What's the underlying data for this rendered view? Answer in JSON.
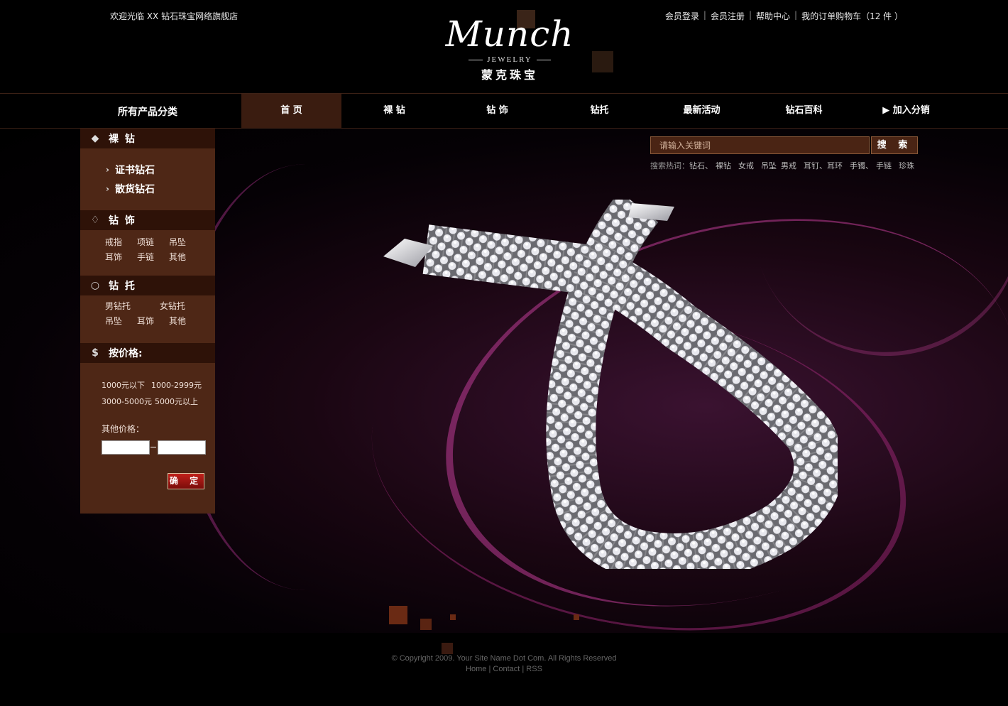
{
  "header": {
    "welcome": "欢迎光临 XX 钻石珠宝网络旗舰店",
    "links": [
      "会员登录",
      "会员注册",
      "帮助中心",
      "我的订单购物车（12 件 ）"
    ],
    "logo_script": "Munch",
    "logo_sub": "JEWELRY",
    "logo_cn": "蒙克珠宝"
  },
  "nav": {
    "all_categories": "所有产品分类",
    "items": [
      "首 页",
      "裸 钻",
      "钻 饰",
      "钻托",
      "最新活动",
      "钻石百科",
      "▶ 加入分销"
    ]
  },
  "sidebar": {
    "loose_diamond": {
      "title": "裸 钻",
      "icon": "diamond-icon",
      "links": [
        "证书钻石",
        "散货钻石"
      ]
    },
    "jewelry": {
      "title": "钻 饰",
      "icon": "shield-gem-icon",
      "items": [
        "戒指",
        "项链",
        "吊坠",
        "耳饰",
        "手链",
        "其他"
      ]
    },
    "mounting": {
      "title": "钻 托",
      "icon": "ring-icon",
      "items": [
        "男钻托",
        "女钻托",
        "吊坠",
        "耳饰",
        "其他"
      ]
    },
    "price": {
      "title": "按价格:",
      "icon": "dollar-icon",
      "options": [
        "1000元以下",
        "1000-2999元",
        "3000-5000元",
        "5000元以上"
      ],
      "other_label": "其他价格：",
      "min_value": "",
      "max_value": "",
      "confirm": "确 定"
    }
  },
  "search": {
    "placeholder": "请输入关键词",
    "button": "搜 索",
    "hot_label": "搜索热词：",
    "hot_words": [
      "钻石、",
      "裸钻",
      "女戒",
      "吊坠",
      "男戒",
      "耳钉、耳环",
      "手镯、",
      "手链",
      "珍珠"
    ]
  },
  "footer": {
    "copyright": "© Copyright 2009. Your Site Name Dot Com. All Rights Reserved",
    "links": [
      "Home",
      "Contact",
      "RSS"
    ]
  },
  "colors": {
    "sidebar_bg": "#4e2716",
    "sidebar_head": "#2e1208",
    "nav_active": "#3a1c10",
    "accent_swirl": "#be3c96"
  }
}
